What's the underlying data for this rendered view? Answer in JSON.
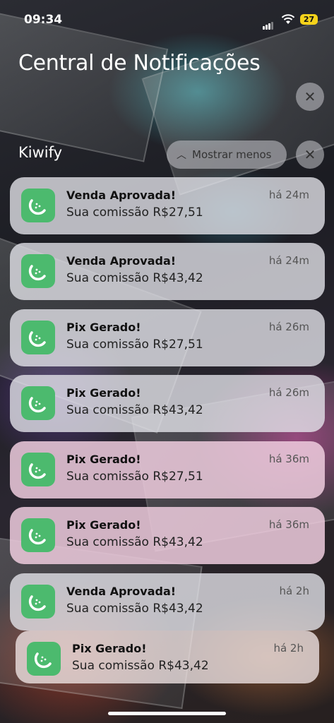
{
  "status_bar": {
    "time": "09:34",
    "battery": "27"
  },
  "header": {
    "title": "Central de Notificações"
  },
  "group": {
    "app_name": "Kiwify",
    "show_less_label": "Mostrar menos"
  },
  "icons": {
    "close": "close-icon",
    "chevron": "chevron-up-icon",
    "app": "kiwify-icon"
  },
  "notifications": [
    {
      "title": "Venda Aprovada!",
      "body": "Sua comissão R$27,51",
      "time": "há 24m"
    },
    {
      "title": "Venda Aprovada!",
      "body": "Sua comissão R$43,42",
      "time": "há 24m"
    },
    {
      "title": "Pix Gerado!",
      "body": "Sua comissão R$27,51",
      "time": "há 26m"
    },
    {
      "title": "Pix Gerado!",
      "body": "Sua comissão R$43,42",
      "time": "há 26m"
    },
    {
      "title": "Pix Gerado!",
      "body": "Sua comissão R$27,51",
      "time": "há 36m"
    },
    {
      "title": "Pix Gerado!",
      "body": "Sua comissão R$43,42",
      "time": "há 36m"
    },
    {
      "title": "Venda Aprovada!",
      "body": "Sua comissão R$43,42",
      "time": "há 2h"
    },
    {
      "title": "Pix Gerado!",
      "body": "Sua comissão R$43,42",
      "time": "há 2h"
    }
  ],
  "colors": {
    "app_icon": "#4cba6e",
    "battery": "#f5d21b"
  }
}
